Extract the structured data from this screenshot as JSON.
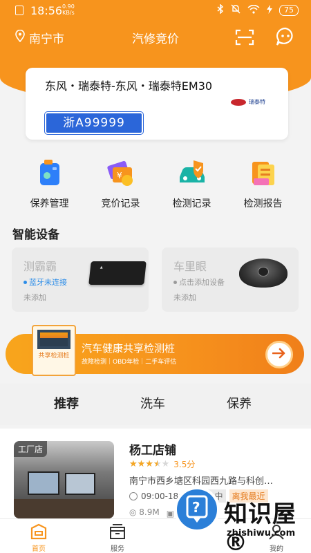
{
  "status_bar": {
    "time": "18:56",
    "net_speed_value": "0.90",
    "net_speed_unit": "KB/s",
    "battery": "75"
  },
  "nav": {
    "location": "南宁市",
    "title": "汽修竞价"
  },
  "car": {
    "name": "东风・瑞泰特-东风・瑞泰特EM30",
    "plate": "浙A99999",
    "brand_logo_text": "瑞泰特"
  },
  "quick_actions": [
    {
      "label": "保养管理",
      "icon": "maintenance-icon"
    },
    {
      "label": "竞价记录",
      "icon": "bid-record-icon"
    },
    {
      "label": "检测记录",
      "icon": "inspection-record-icon"
    },
    {
      "label": "检测报告",
      "icon": "inspection-report-icon"
    }
  ],
  "smart_devices": {
    "title": "智能设备",
    "items": [
      {
        "name": "测霸霸",
        "status": "蓝牙未连接",
        "note": "未添加",
        "status_color": "#2b8ce8"
      },
      {
        "name": "车里眼",
        "status": "点击添加设备",
        "note": "未添加",
        "status_color": "#9a9a9a"
      }
    ]
  },
  "banner": {
    "title": "汽车健康共享检测桩",
    "subtitle": "故障检测｜OBD年检｜二手车评估",
    "kiosk_text": "共享检测桩"
  },
  "tabs": [
    "推荐",
    "洗车",
    "保养"
  ],
  "shop": {
    "tag": "工厂店",
    "name": "杨工店铺",
    "rating": "3.5分",
    "rating_value": 3.5,
    "address": "南宁市西乡塘区科园西九路与科创…",
    "hours": "09:00-18:00",
    "status": "休息中",
    "nearest": "离我最近",
    "distance": "8.9M",
    "orders": "0单"
  },
  "bottom_nav": [
    {
      "label": "首页",
      "icon": "home-icon"
    },
    {
      "label": "服务",
      "icon": "service-icon"
    },
    {
      "label": "我的",
      "icon": "profile-icon"
    }
  ],
  "watermark": {
    "text": "知识屋®",
    "domain": "zhishiwu.com"
  },
  "colors": {
    "brand_orange": "#f7941d",
    "plate_blue": "#2b66d9"
  }
}
